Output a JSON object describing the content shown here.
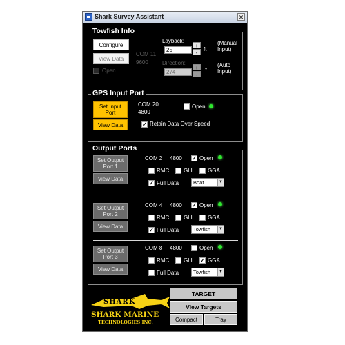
{
  "window": {
    "title": "Shark Survey Assistant",
    "close_glyph": "✕"
  },
  "towfish": {
    "title": "Towfish Info",
    "configure_label": "Configure",
    "view_data_label": "View Data",
    "open_label": "Open",
    "com": "COM 11",
    "baud": "9600",
    "layback_label": "Layback:",
    "layback_value": "25",
    "layback_unit": "ft",
    "manual_input": "(Manual Input)",
    "direction_label": "Direction:",
    "direction_value": "274",
    "direction_unit": "°",
    "auto_input": "(Auto Input)",
    "spin_up": "+",
    "spin_down": "-"
  },
  "gps": {
    "title": "GPS Input Port",
    "set_input_label": "Set Input Port",
    "view_data_label": "View Data",
    "com": "COM 20",
    "baud": "4800",
    "open_label": "Open",
    "retain_label": "Retain Data Over Speed"
  },
  "output": {
    "title": "Output Ports",
    "ports": [
      {
        "set_label": "Set Output Port 1",
        "view_label": "View Data",
        "com": "COM 2",
        "baud": "4800",
        "open_label": "Open",
        "rmc": "RMC",
        "gll": "GLL",
        "gga": "GGA",
        "full_data": "Full Data",
        "source": "Boat"
      },
      {
        "set_label": "Set Output Port 2",
        "view_label": "View Data",
        "com": "COM 4",
        "baud": "4800",
        "open_label": "Open",
        "rmc": "RMC",
        "gll": "GLL",
        "gga": "GGA",
        "full_data": "Full Data",
        "source": "Towfish"
      },
      {
        "set_label": "Set Output Port 3",
        "view_label": "View Data",
        "com": "COM 8",
        "baud": "4800",
        "open_label": "Open",
        "rmc": "RMC",
        "gll": "GLL",
        "gga": "GGA",
        "full_data": "Full Data",
        "source": "Towfish"
      }
    ]
  },
  "footer": {
    "logo_word": "SHARK",
    "brand_line1": "SHARK MARINE",
    "brand_line2": "TECHNOLOGIES INC.",
    "target_label": "TARGET",
    "view_targets_label": "View Targets",
    "compact_label": "Compact",
    "tray_label": "Tray"
  },
  "check_glyph": "✓",
  "arrow_glyph": "▼",
  "colors": {
    "accent_yellow": "#ffc200",
    "led_green": "#2ee82e",
    "logo_yellow": "#f6d215"
  }
}
